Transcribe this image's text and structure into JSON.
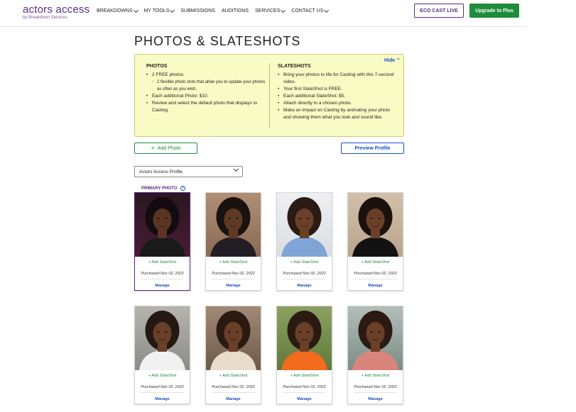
{
  "header": {
    "logo_main": "actors access",
    "logo_sub": "by Breakdown Services",
    "nav": [
      "BREAKDOWNS",
      "MY TOOLS",
      "SUBMISSIONS",
      "AUDITIONS",
      "SERVICES",
      "CONTACT US"
    ],
    "eco_button": "ECO CAST LIVE",
    "upgrade_button": "Upgrade to Plus"
  },
  "page_title": "PHOTOS & SLATESHOTS",
  "info": {
    "hide": "Hide",
    "photos_head": "PHOTOS",
    "photos_items": [
      "2 FREE photos.",
      "2 flexible photo slots that allow you to update your photos as often as you wish.",
      "Each additional Photo: $10.",
      "Review and select the default photo that displays to Casting."
    ],
    "slates_head": "SLATESHOTS",
    "slates_items": [
      "Bring your photos to life for Casting with this 7-second video.",
      "Your first SlateShot is FREE.",
      "Each additional SlateShot: $5.",
      "Attach directly to a chosen photo.",
      "Make an impact on Casting by animating your photo and showing them what you look and sound like."
    ]
  },
  "actions": {
    "add_photo": "Add Photo",
    "preview_profile": "Preview Profile"
  },
  "profile_select": "Actors Access Profile",
  "primary_label": "PRIMARY PHOTO",
  "cards": [
    {
      "slate": "+ Add SlateShot",
      "purchased": "Purchased Nov 02, 2022",
      "manage": "Manage",
      "bg": "#4a1b33",
      "top": "#2a1621",
      "hair": "#140b10",
      "skin": "#5a3524",
      "outfit": "#1a1a1a"
    },
    {
      "slate": "+ Add SlateShot",
      "purchased": "Purchased Nov 02, 2022",
      "manage": "Manage",
      "bg": "#8a6a55",
      "top": "#b08f76",
      "hair": "#1a120e",
      "skin": "#5f3a26",
      "outfit": "#231d25"
    },
    {
      "slate": "+ Add SlateShot",
      "purchased": "Purchased Nov 02, 2022",
      "manage": "Manage",
      "bg": "#d9dde2",
      "top": "#eef0f2",
      "hair": "#2a1b14",
      "skin": "#6b4028",
      "outfit": "#7fa4d6"
    },
    {
      "slate": "+ Add SlateShot",
      "purchased": "Purchased Nov 02, 2022",
      "manage": "Manage",
      "bg": "#b9a48c",
      "top": "#d2c0ab",
      "hair": "#1c120d",
      "skin": "#6a3f28",
      "outfit": "#121212"
    },
    {
      "slate": "+ Add SlateShot",
      "purchased": "Purchased Nov 02, 2022",
      "manage": "Manage",
      "bg": "#8c8c88",
      "top": "#b5b4ad",
      "hair": "#241812",
      "skin": "#6a3f28",
      "outfit": "#f1f1f1"
    },
    {
      "slate": "+ Add SlateShot",
      "purchased": "Purchased Nov 02, 2022",
      "manage": "Manage",
      "bg": "#6e5a4a",
      "top": "#a18a76",
      "hair": "#2b1a12",
      "skin": "#6a3f28",
      "outfit": "#e9dccb"
    },
    {
      "slate": "+ Add SlateShot",
      "purchased": "Purchased Nov 02, 2022",
      "manage": "Manage",
      "bg": "#5f7a3c",
      "top": "#8ca061",
      "hair": "#2a1a12",
      "skin": "#6a3f28",
      "outfit": "#f36b1c"
    },
    {
      "slate": "+ Add SlateShot",
      "purchased": "Purchased Nov 02, 2022",
      "manage": "Manage",
      "bg": "#7c8c86",
      "top": "#b3beb9",
      "hair": "#2b1a12",
      "skin": "#6a3f28",
      "outfit": "#d9857c"
    }
  ],
  "colors": {
    "brand": "#5a2a82",
    "green": "#1e8c3a",
    "link": "#1a4fc0",
    "info_bg": "#f8fbc4"
  }
}
